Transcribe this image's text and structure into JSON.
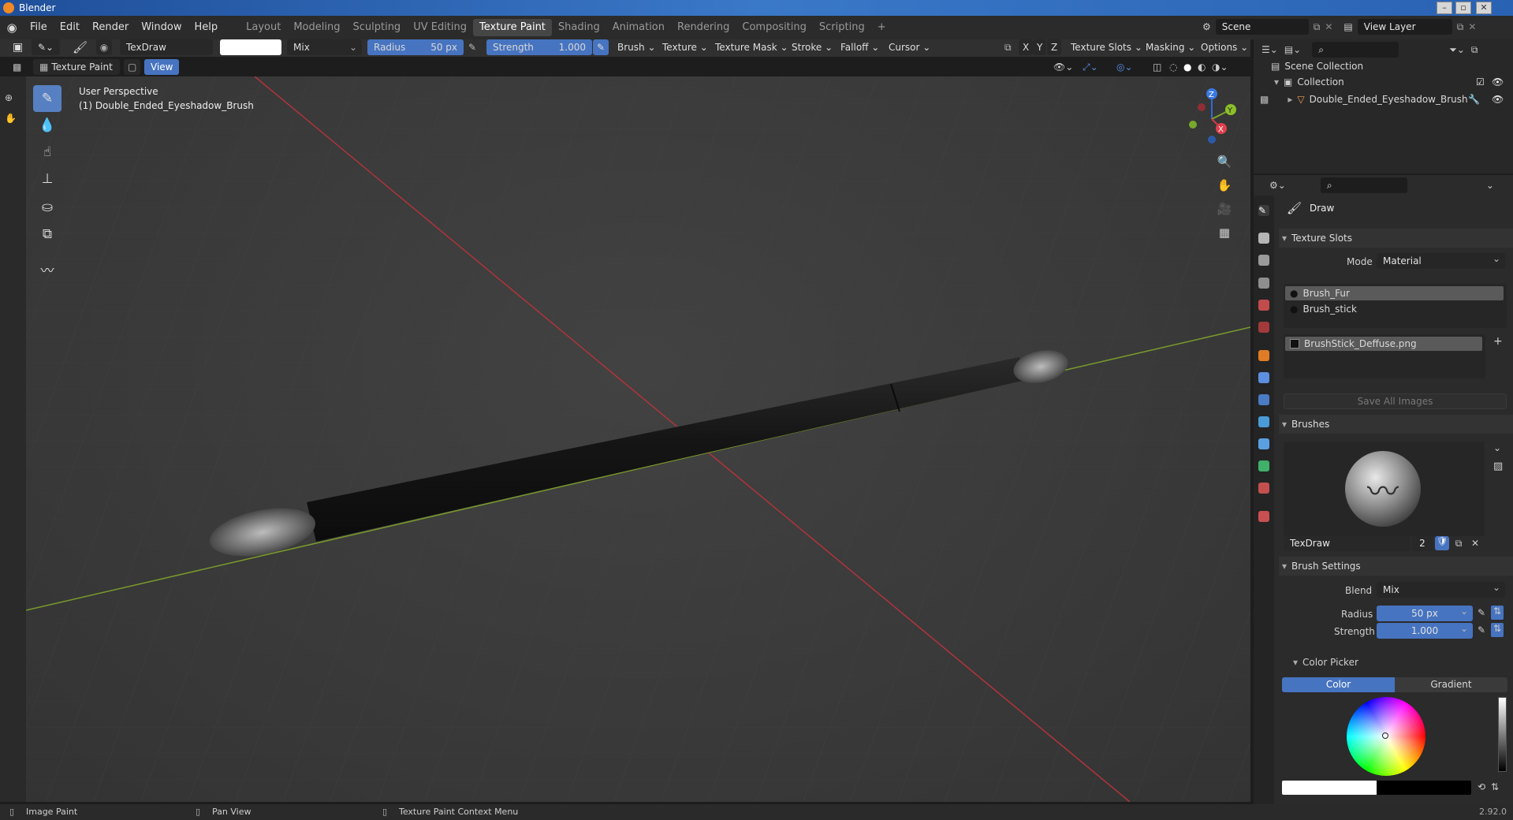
{
  "window": {
    "title": "Blender"
  },
  "menu": [
    "File",
    "Edit",
    "Render",
    "Window",
    "Help"
  ],
  "workspaces": {
    "tabs": [
      "Layout",
      "Modeling",
      "Sculpting",
      "UV Editing",
      "Texture Paint",
      "Shading",
      "Animation",
      "Rendering",
      "Compositing",
      "Scripting"
    ],
    "active": "Texture Paint"
  },
  "scene": {
    "name": "Scene",
    "view_layer": "View Layer"
  },
  "tool_header": {
    "brush_name": "TexDraw",
    "blend": "Mix",
    "radius_label": "Radius",
    "radius_value": "50 px",
    "strength_label": "Strength",
    "strength_value": "1.000",
    "menus": [
      "Brush",
      "Texture",
      "Texture Mask",
      "Stroke",
      "Falloff",
      "Cursor"
    ],
    "axes": [
      "X",
      "Y",
      "Z"
    ],
    "right_menus": [
      "Texture Slots",
      "Masking",
      "Options"
    ]
  },
  "header2": {
    "mode": "Texture Paint",
    "view": "View"
  },
  "viewport": {
    "overlay_line1": "User Perspective",
    "overlay_line2": "(1) Double_Ended_Eyeshadow_Brush",
    "gizmo": {
      "z": "Z",
      "y": "Y",
      "x": "X"
    },
    "colors": {
      "x_axis": "#c8333b",
      "y_axis": "#7c9c2a",
      "background": "#3d3d3d"
    }
  },
  "outliner": {
    "scene_collection": "Scene Collection",
    "collection": "Collection",
    "object": "Double_Ended_Eyeshadow_Brush"
  },
  "properties": {
    "active_tool": "Draw",
    "texture_slots": {
      "title": "Texture Slots",
      "mode_label": "Mode",
      "mode_value": "Material",
      "materials": [
        "Brush_Fur",
        "Brush_stick"
      ],
      "image": "BrushStick_Deffuse.png",
      "save_all": "Save All Images"
    },
    "brushes": {
      "title": "Brushes",
      "brush_name": "TexDraw",
      "users": "2"
    },
    "brush_settings": {
      "title": "Brush Settings",
      "blend_label": "Blend",
      "blend_value": "Mix",
      "radius_label": "Radius",
      "radius_value": "50 px",
      "strength_label": "Strength",
      "strength_value": "1.000"
    },
    "color_picker": {
      "title": "Color Picker",
      "tab_color": "Color",
      "tab_gradient": "Gradient"
    }
  },
  "status": {
    "left": "Image Paint",
    "middle": "Pan View",
    "right": "Texture Paint Context Menu",
    "version": "2.92.0"
  },
  "accent": "#4774c0"
}
